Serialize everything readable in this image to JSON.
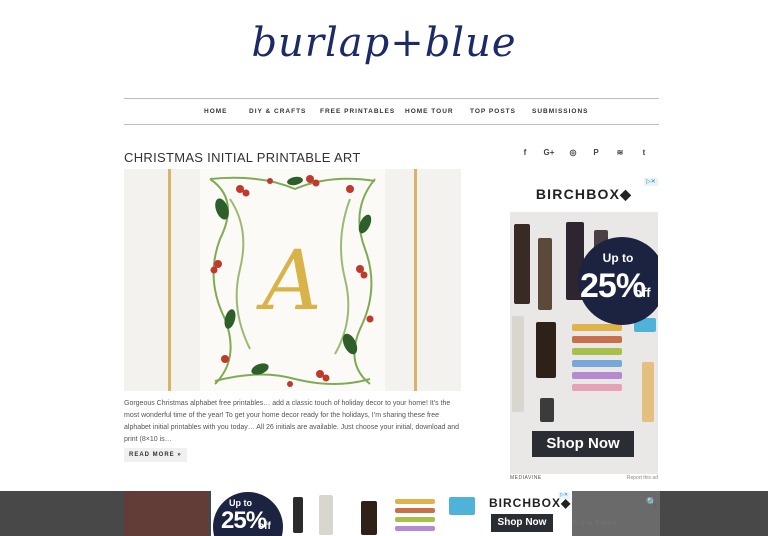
{
  "site": {
    "logo": "burlap+blue"
  },
  "nav": {
    "items": [
      "HOME",
      "DIY & CRAFTS",
      "FREE PRINTABLES",
      "HOME TOUR",
      "TOP POSTS",
      "SUBMISSIONS"
    ]
  },
  "post": {
    "title": "CHRISTMAS INITIAL PRINTABLE ART",
    "image_letter": "A",
    "excerpt": "Gorgeous Christmas alphabet free printables… add a classic touch of holiday decor to your home! It’s the most wonderful time of the year! To get your home decor ready for the holidays, I’m sharing these free alphabet initial printables with you today… All 26 initials are available. Just choose your initial, download and print (8×10 is…",
    "read_more": "READ MORE »"
  },
  "social": {
    "icons": [
      "facebook-icon",
      "google-plus-icon",
      "instagram-icon",
      "pinterest-icon",
      "rss-icon",
      "twitter-icon"
    ],
    "glyphs": [
      "f",
      "G+",
      "◎",
      "P",
      "≋",
      "t"
    ]
  },
  "ad": {
    "brand": "BIRCHBOX",
    "brand_mark": "◆",
    "close": "▷✕",
    "up_to": "Up to",
    "percent": "25%",
    "off": "off",
    "cta": "Shop Now",
    "footer": "MEDIAVINE",
    "report": "Report this ad"
  },
  "banner": {
    "up_to": "Up to",
    "percent": "25%",
    "off": "off",
    "brand": "BIRCHBOX",
    "brand_mark": "◆",
    "cta": "Shop Now",
    "close": "▷✕"
  },
  "sidebar": {
    "search_glyph": "🔍",
    "subscribe_partial": "BE VIA EMAIL"
  },
  "colors": {
    "logo": "#1c2a66",
    "badge": "#1b2340",
    "gold": "#d7b46a",
    "berry": "#c0392b",
    "pine": "#6b9e3a"
  }
}
